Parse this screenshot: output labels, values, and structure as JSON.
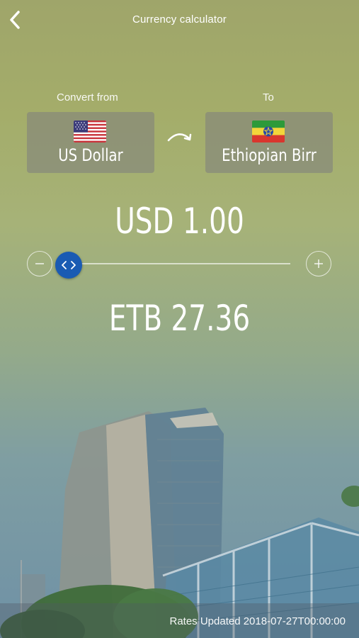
{
  "header": {
    "title": "Currency calculator",
    "back_icon": "chevron-left-icon"
  },
  "converter": {
    "from_label": "Convert from",
    "to_label": "To",
    "from_currency": "US Dollar",
    "to_currency": "Ethiopian Birr",
    "from_flag": "us-flag-icon",
    "to_flag": "ethiopia-flag-icon",
    "swap_icon": "curved-arrow-icon"
  },
  "amounts": {
    "from_amount": "USD 1.00",
    "to_amount": "ETB 27.36",
    "slider_position": 0
  },
  "footer": {
    "rates_updated": "Rates Updated 2018-07-27T00:00:00"
  },
  "colors": {
    "accent": "#1a5bb3"
  }
}
